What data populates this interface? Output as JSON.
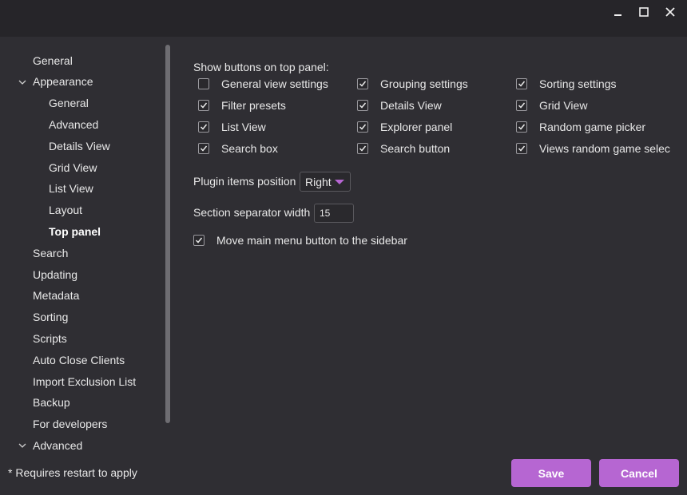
{
  "window": {
    "minimize_icon": "minimize-icon",
    "maximize_icon": "maximize-icon",
    "close_icon": "close-icon"
  },
  "sidebar": {
    "items": [
      {
        "label": "General",
        "level": 0
      },
      {
        "label": "Appearance",
        "level": 0,
        "expanded": true
      },
      {
        "label": "General",
        "level": 1
      },
      {
        "label": "Advanced",
        "level": 1
      },
      {
        "label": "Details View",
        "level": 1
      },
      {
        "label": "Grid View",
        "level": 1
      },
      {
        "label": "List View",
        "level": 1
      },
      {
        "label": "Layout",
        "level": 1
      },
      {
        "label": "Top panel",
        "level": 1,
        "active": true
      },
      {
        "label": "Search",
        "level": 0
      },
      {
        "label": "Updating",
        "level": 0
      },
      {
        "label": "Metadata",
        "level": 0
      },
      {
        "label": "Sorting",
        "level": 0
      },
      {
        "label": "Scripts",
        "level": 0
      },
      {
        "label": "Auto Close Clients",
        "level": 0
      },
      {
        "label": "Import Exclusion List",
        "level": 0
      },
      {
        "label": "Backup",
        "level": 0
      },
      {
        "label": "For developers",
        "level": 0
      },
      {
        "label": "Advanced",
        "level": 0,
        "expanded": true
      }
    ]
  },
  "main": {
    "section_title": "Show buttons on top panel:",
    "checkboxes": [
      {
        "label": "General view settings",
        "checked": false
      },
      {
        "label": "Grouping settings",
        "checked": true
      },
      {
        "label": "Sorting settings",
        "checked": true
      },
      {
        "label": "Filter presets",
        "checked": true
      },
      {
        "label": "Details View",
        "checked": true
      },
      {
        "label": "Grid View",
        "checked": true
      },
      {
        "label": "List View",
        "checked": true
      },
      {
        "label": "Explorer panel",
        "checked": true
      },
      {
        "label": "Random game picker",
        "checked": true
      },
      {
        "label": "Search box",
        "checked": true
      },
      {
        "label": "Search button",
        "checked": true
      },
      {
        "label": "Views random game selec",
        "checked": true
      }
    ],
    "plugin_position_label": "Plugin items position",
    "plugin_position_value": "Right",
    "separator_width_label": "Section separator width",
    "separator_width_value": "15",
    "move_menu": {
      "label": "Move main menu button to the sidebar",
      "checked": true
    }
  },
  "footer": {
    "note": "* Requires restart to apply",
    "save_label": "Save",
    "cancel_label": "Cancel"
  },
  "colors": {
    "accent": "#b666d2",
    "background": "#2f2e33",
    "titlebar": "#262529"
  }
}
